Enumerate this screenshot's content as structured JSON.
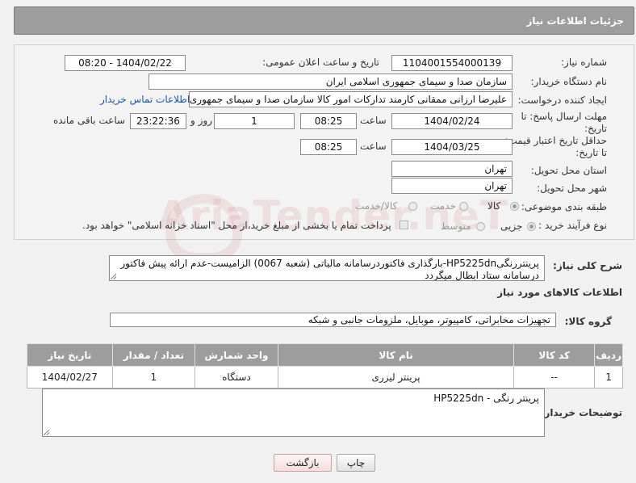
{
  "header": {
    "title": "جزئیات اطلاعات نیاز"
  },
  "form": {
    "need_number": {
      "label": "شماره نیاز:",
      "value": "1104001554000139"
    },
    "announce": {
      "label": "تاریخ و ساعت اعلان عمومی:",
      "value": "1404/02/22 - 08:20"
    },
    "buyer_org": {
      "label": "نام دستگاه خریدار:",
      "value": "سازمان صدا و سیمای جمهوری اسلامی ایران"
    },
    "creator": {
      "label": "ایجاد کننده درخواست:",
      "value": "علیرضا ارزانی ممقانی کارمند تدارکات امور کالا سازمان صدا و سیمای جمهوری ا",
      "contact_link": "اطلاعات تماس خریدار"
    },
    "reply_deadline": {
      "label_line1": "مهلت ارسال پاسخ: تا",
      "label_line2": "تاریخ:",
      "date": "1404/02/24",
      "time_label": "ساعت",
      "time": "08:25",
      "days": "1",
      "days_label": "روز و",
      "remaining": "23:22:36",
      "remaining_label": "ساعت باقی مانده"
    },
    "price_validity": {
      "label_line1": "حداقل تاریخ اعتبار قیمت:",
      "label_line2": "تا تاریخ:",
      "date": "1404/03/25",
      "time_label": "ساعت",
      "time": "08:25"
    },
    "province": {
      "label": "استان محل تحویل:",
      "value": "تهران"
    },
    "city": {
      "label": "شهر محل تحویل:",
      "value": "تهران"
    },
    "category": {
      "label": "طبقه بندی موضوعی:",
      "options": [
        "کالا",
        "خدمت",
        "کالا/خدمت"
      ],
      "selected": "کالا"
    },
    "process": {
      "label": "نوع فرآیند خرید :",
      "options": [
        "جزیی",
        "متوسط"
      ],
      "selected": "جزیی",
      "payment_note": "پرداخت تمام یا بخشی از مبلغ خرید،از محل \"اسناد خزانه اسلامی\" خواهد بود."
    }
  },
  "description": {
    "label": "شرح کلی نیاز:",
    "line1": "پرینتررنگیHP5225dn-بارگذاری فاکتوردرسامانه مالیاتی (شعبه 0067) الزامیست-عدم ارائه پیش فاکتور",
    "line2": "درسامانه ستاد ابطال میگردد"
  },
  "goods_section": {
    "title": "اطلاعات کالاهای مورد نیاز",
    "group_label": "گروه کالا:",
    "group_value": "تجهیزات مخابراتی، کامپیوتر، موبایل، ملزومات جانبی و شبکه"
  },
  "table": {
    "headers": [
      "ردیف",
      "کد کالا",
      "نام کالا",
      "واحد شمارش",
      "تعداد / مقدار",
      "تاریخ نیاز"
    ],
    "rows": [
      [
        "1",
        "--",
        "پرینتر لیزری",
        "دستگاه",
        "1",
        "1404/02/27"
      ]
    ]
  },
  "buyer_notes": {
    "label": "توضیحات خریدار:",
    "value": "پرینتر رنگی - HP5225dn"
  },
  "buttons": {
    "print": "چاپ",
    "back": "بازگشت"
  },
  "watermark": {
    "text": "AriaTender.neT"
  }
}
